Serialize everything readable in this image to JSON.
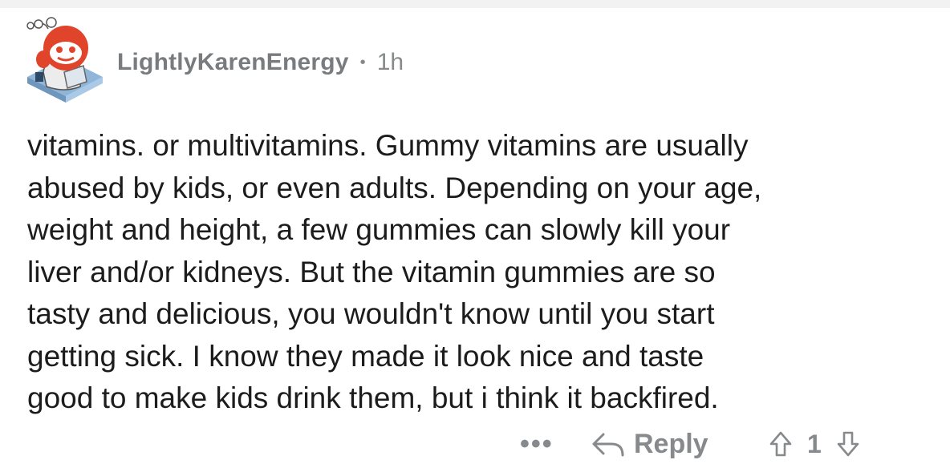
{
  "comment": {
    "username": "LightlyKarenEnergy",
    "separator": "•",
    "timestamp": "1h",
    "body": "vitamins. or multivitamins. Gummy vitamins are usually\nabused by kids, or even adults. Depending on your age,\nweight and height, a few gummies can slowly kill your\nliver and/or kidneys. But the vitamin gummies are so\ntasty and delicious, you wouldn't know until you start\ngetting sick. I know they made it look nice and taste\ngood to make kids drink them, but i think it backfired.",
    "avatar_icon": "snoo-avatar-icon"
  },
  "actions": {
    "more_label": "•••",
    "reply_label": "Reply",
    "reply_icon": "reply-arrow-icon",
    "upvote_icon": "upvote-arrow-icon",
    "downvote_icon": "downvote-arrow-icon",
    "vote_count": "1"
  },
  "colors": {
    "meta_gray": "#878a8c",
    "text_dark": "#1c1c1c",
    "avatar_red": "#e0442a",
    "avatar_blue": "#8fb6d9"
  }
}
